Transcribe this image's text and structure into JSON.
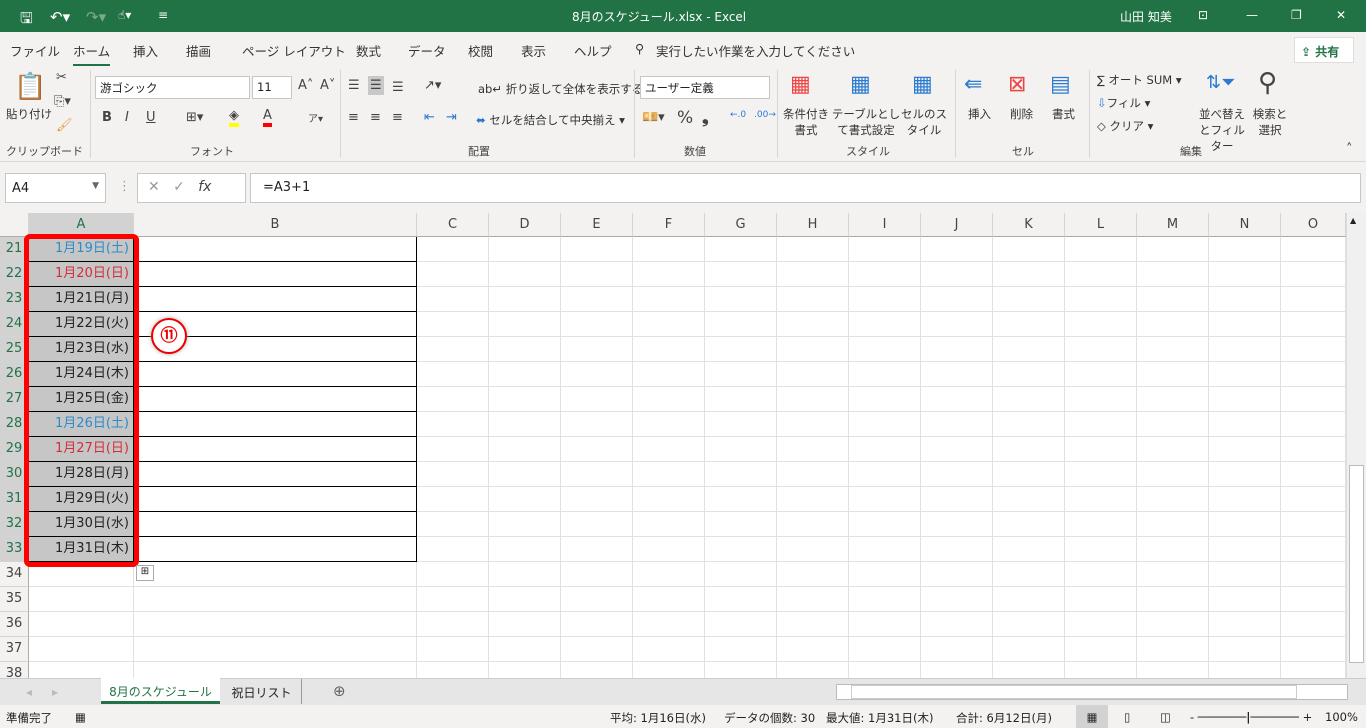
{
  "title": {
    "filename": "8月のスケジュール.xlsx  -  Excel",
    "user": "山田 知美"
  },
  "menu": {
    "tabs": [
      "ファイル",
      "ホーム",
      "挿入",
      "描画",
      "ページ レイアウト",
      "数式",
      "データ",
      "校閲",
      "表示",
      "ヘルプ"
    ],
    "search": "実行したい作業を入力してください",
    "share": "共有"
  },
  "ribbon": {
    "clipboard": {
      "paste": "貼り付け",
      "label": "クリップボード"
    },
    "font": {
      "name": "游ゴシック",
      "size": "11",
      "bold": "B",
      "italic": "I",
      "underline": "U",
      "label": "フォント"
    },
    "align": {
      "wrap": "折り返して全体を表示する",
      "merge": "セルを結合して中央揃え",
      "label": "配置"
    },
    "number": {
      "format": "ユーザー定義",
      "percent": "%",
      "comma": "9",
      "label": "数値"
    },
    "styles": {
      "cond": "条件付き書式",
      "table": "テーブルとして書式設定",
      "cell": "セルのスタイル",
      "label": "スタイル"
    },
    "cells": {
      "insert": "挿入",
      "delete": "削除",
      "format": "書式",
      "label": "セル"
    },
    "editing": {
      "autosum": "オート SUM",
      "fill": "フィル",
      "clear": "クリア",
      "sort": "並べ替えとフィルター",
      "find": "検索と選択",
      "label": "編集"
    },
    "colors": {
      "accent": "#217346",
      "highlight": "#ffff00",
      "fontcolor": "#ff0000"
    }
  },
  "formula": {
    "namebox": "A4",
    "fx": "fx",
    "value": "=A3+1"
  },
  "columns": [
    "A",
    "B",
    "C",
    "D",
    "E",
    "F",
    "G",
    "H",
    "I",
    "J",
    "K",
    "L",
    "M",
    "N",
    "O"
  ],
  "rows": [
    {
      "n": "21",
      "a": "1月19日(土)",
      "color": "#2e8bc9"
    },
    {
      "n": "22",
      "a": "1月20日(日)",
      "color": "#d42d3a"
    },
    {
      "n": "23",
      "a": "1月21日(月)",
      "color": "#222"
    },
    {
      "n": "24",
      "a": "1月22日(火)",
      "color": "#222"
    },
    {
      "n": "25",
      "a": "1月23日(水)",
      "color": "#222"
    },
    {
      "n": "26",
      "a": "1月24日(木)",
      "color": "#222"
    },
    {
      "n": "27",
      "a": "1月25日(金)",
      "color": "#222"
    },
    {
      "n": "28",
      "a": "1月26日(土)",
      "color": "#2e8bc9"
    },
    {
      "n": "29",
      "a": "1月27日(日)",
      "color": "#d42d3a"
    },
    {
      "n": "30",
      "a": "1月28日(月)",
      "color": "#222"
    },
    {
      "n": "31",
      "a": "1月29日(火)",
      "color": "#222"
    },
    {
      "n": "32",
      "a": "1月30日(水)",
      "color": "#222"
    },
    {
      "n": "33",
      "a": "1月31日(木)",
      "color": "#222"
    },
    {
      "n": "34",
      "a": ""
    },
    {
      "n": "35",
      "a": ""
    },
    {
      "n": "36",
      "a": ""
    },
    {
      "n": "37",
      "a": ""
    },
    {
      "n": "38",
      "a": ""
    }
  ],
  "annotation": "⑪",
  "sheets": [
    "8月のスケジュール",
    "祝日リスト"
  ],
  "status": {
    "ready": "準備完了",
    "average": "平均: 1月16日(水)",
    "count": "データの個数: 30",
    "max": "最大値: 1月31日(木)",
    "sum": "合計: 6月12日(月)",
    "zoom": "100%"
  }
}
